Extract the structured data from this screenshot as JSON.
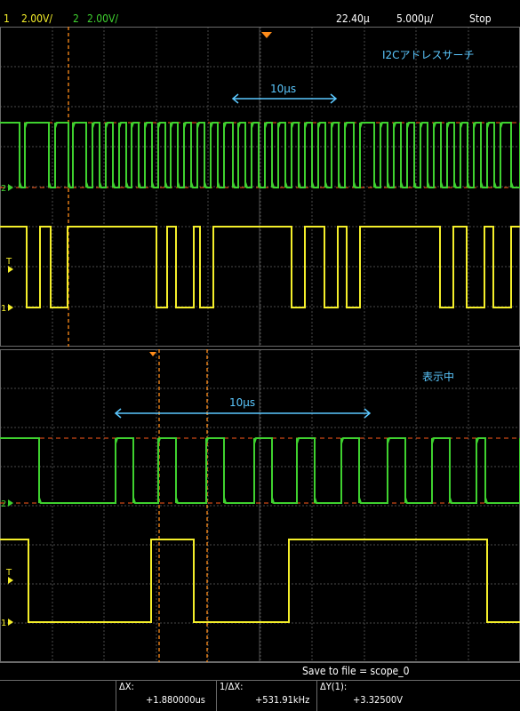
{
  "header": {
    "ch1_num": "1",
    "ch1_scale": "2.00V/",
    "ch2_num": "2",
    "ch2_scale": "2.00V/",
    "trigger_delay": "22.40µ",
    "timebase": "5.000µ/",
    "run_state": "Stop"
  },
  "upper_pane": {
    "title": "I2Cアドレスサーチ",
    "span_label": "10µs",
    "ch2_marker": "2",
    "trigger_marker": "T",
    "ch1_marker": "1"
  },
  "lower_pane": {
    "title": "表示中",
    "span_label": "10µs",
    "ch2_marker": "2",
    "trigger_marker": "T",
    "ch1_marker": "1"
  },
  "measurements": {
    "save_label": "Save to file = scope_0",
    "dx_label": "ΔX:",
    "dx_value": "+1.880000us",
    "inv_dx_label": "1/ΔX:",
    "inv_dx_value": "+531.91kHz",
    "dy_label": "ΔY(1):",
    "dy_value": "+3.32500V"
  },
  "colors": {
    "ch1": "#f4ee2a",
    "ch2": "#3fd12f",
    "cursor": "#ff8c1a",
    "annotation": "#5bc8ff",
    "grid": "#4a4a4a"
  },
  "upper_signals": {
    "sda_edges": [
      22,
      28,
      55,
      62,
      77,
      82,
      97,
      104,
      112,
      119,
      127,
      134,
      142,
      148,
      156,
      163,
      171,
      178,
      186,
      192,
      200,
      207,
      215,
      222,
      230,
      237,
      245,
      252,
      262,
      268,
      276,
      283,
      291,
      298,
      306,
      313,
      321,
      328,
      336,
      343,
      351,
      358,
      366,
      373,
      381,
      388,
      398,
      405,
      421,
      428,
      436,
      443,
      451,
      458,
      466,
      473,
      481,
      488,
      496,
      503,
      511,
      518,
      526,
      533,
      541,
      548,
      556,
      563,
      575,
      585
    ],
    "scl_edges": [
      30,
      45,
      57,
      76,
      176,
      188,
      198,
      218,
      225,
      240,
      328,
      343,
      365,
      380,
      390,
      405,
      495,
      510,
      525,
      545,
      555,
      575
    ]
  },
  "lower_signals": {
    "sda_edges": [
      44,
      130,
      150,
      178,
      198,
      232,
      252,
      286,
      306,
      334,
      354,
      384,
      404,
      436,
      456,
      486,
      506,
      536,
      546,
      585
    ],
    "scl_edges": [
      32,
      170,
      218,
      325,
      548
    ]
  }
}
